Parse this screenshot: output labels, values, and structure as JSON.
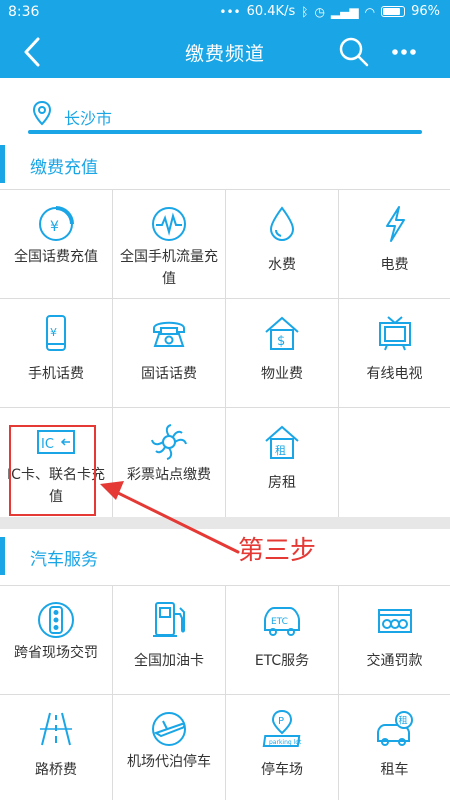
{
  "status_bar": {
    "time": "8:36",
    "net_speed": "60.4K/s",
    "battery": "96%"
  },
  "nav": {
    "title": "缴费频道"
  },
  "location": {
    "city": "长沙市"
  },
  "sections": [
    {
      "title": "缴费充值",
      "items": [
        {
          "label": "全国话费充值",
          "icon": "phone-bill-icon"
        },
        {
          "label": "全国手机流量充值",
          "icon": "mobile-data-icon"
        },
        {
          "label": "水费",
          "icon": "water-drop-icon"
        },
        {
          "label": "电费",
          "icon": "lightning-icon"
        },
        {
          "label": "手机话费",
          "icon": "mobile-phone-icon"
        },
        {
          "label": "固话话费",
          "icon": "landline-phone-icon"
        },
        {
          "label": "物业费",
          "icon": "property-fee-icon"
        },
        {
          "label": "有线电视",
          "icon": "tv-icon"
        },
        {
          "label": "IC卡、联名卡充值",
          "icon": "ic-card-icon"
        },
        {
          "label": "彩票站点缴费",
          "icon": "lottery-icon"
        },
        {
          "label": "房租",
          "icon": "rent-house-icon"
        }
      ]
    },
    {
      "title": "汽车服务",
      "items": [
        {
          "label": "跨省现场交罚",
          "icon": "traffic-light-icon"
        },
        {
          "label": "全国加油卡",
          "icon": "fuel-pump-icon"
        },
        {
          "label": "ETC服务",
          "icon": "etc-car-icon"
        },
        {
          "label": "交通罚款",
          "icon": "traffic-fine-icon"
        },
        {
          "label": "路桥费",
          "icon": "road-icon"
        },
        {
          "label": "机场代泊停车",
          "icon": "airplane-icon"
        },
        {
          "label": "停车场",
          "icon": "parking-icon"
        },
        {
          "label": "租车",
          "icon": "car-rental-icon"
        }
      ]
    }
  ],
  "annotation": {
    "text": "第三步"
  },
  "colors": {
    "accent": "#1aa6e6",
    "annotation": "#e53935"
  }
}
